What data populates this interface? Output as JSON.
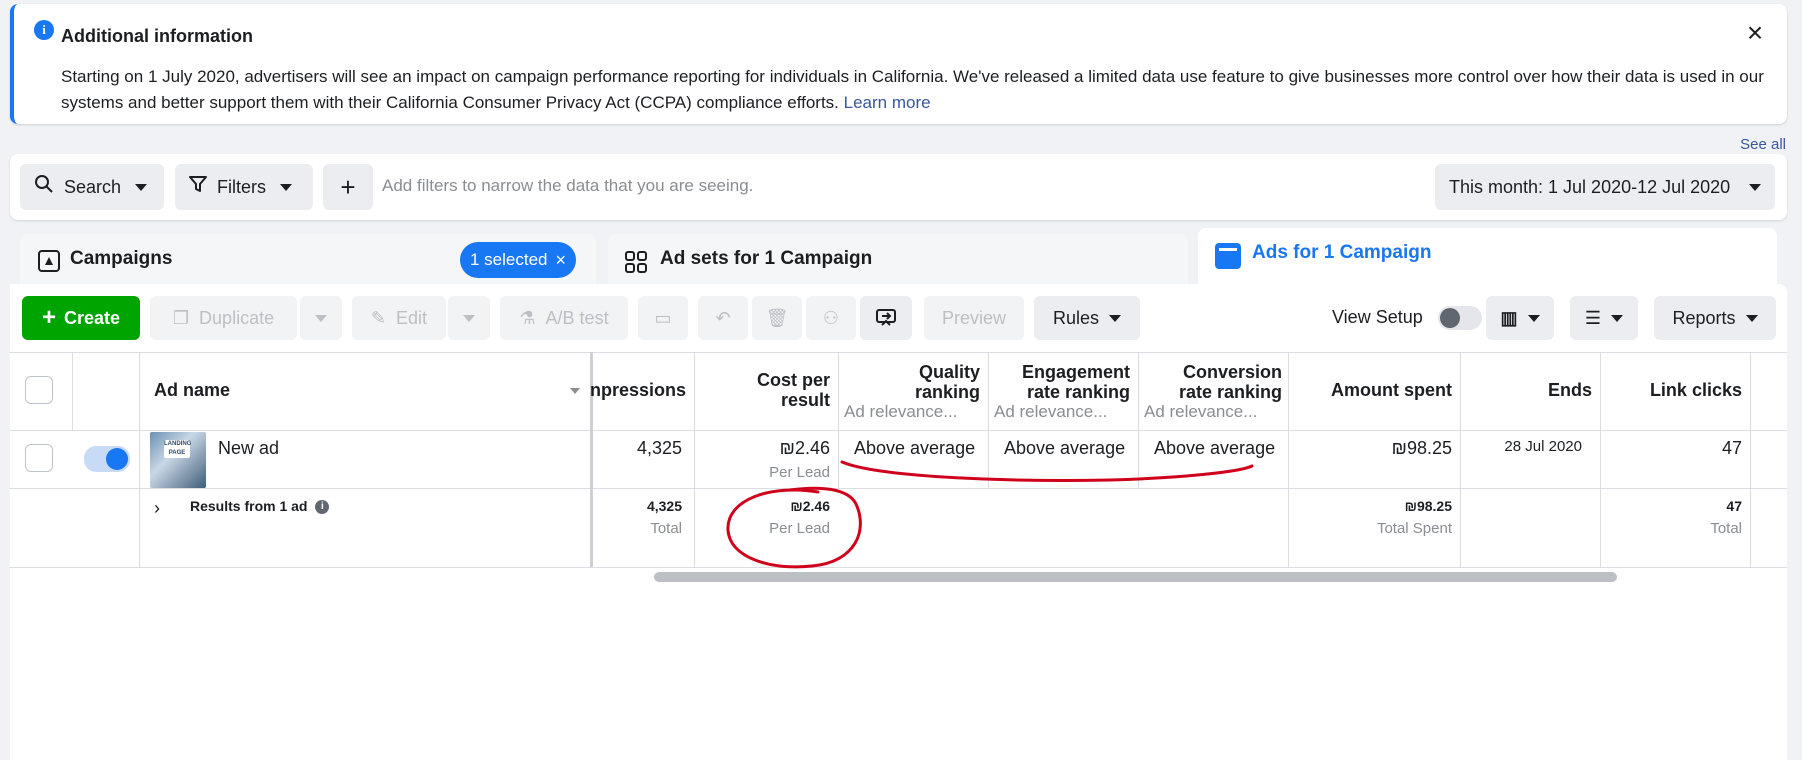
{
  "banner": {
    "title": "Additional information",
    "text": "Starting on 1 July 2020, advertisers will see an impact on campaign performance reporting for individuals in California. We've released a limited data use feature to give businesses more control over how their data is used in our systems and better support them with their California Consumer Privacy Act (CCPA) compliance efforts.",
    "link": "Learn more"
  },
  "see_all": "See all",
  "filters": {
    "search": "Search",
    "filters": "Filters",
    "add": "+",
    "placeholder": "Add filters to narrow the data that you are seeing.",
    "date_range": "This month: 1 Jul 2020-12 Jul 2020"
  },
  "tabs": {
    "campaigns": "Campaigns",
    "selected": "1 selected",
    "adsets": "Ad sets for 1 Campaign",
    "ads": "Ads for 1 Campaign"
  },
  "toolbar": {
    "create": "Create",
    "duplicate": "Duplicate",
    "edit": "Edit",
    "ab_test": "A/B test",
    "preview": "Preview",
    "rules": "Rules",
    "view_setup": "View Setup",
    "reports": "Reports"
  },
  "table": {
    "headers": {
      "ad_name": "Ad name",
      "impressions": "npressions",
      "cost_per_result_1": "Cost per",
      "cost_per_result_2": "result",
      "quality_1": "Quality",
      "quality_2": "ranking",
      "quality_sub": "Ad relevance...",
      "engagement_1": "Engagement",
      "engagement_2": "rate ranking",
      "engagement_sub": "Ad relevance...",
      "conversion_1": "Conversion",
      "conversion_2": "rate ranking",
      "conversion_sub": "Ad relevance...",
      "amount_spent": "Amount spent",
      "ends": "Ends",
      "link_clicks": "Link clicks"
    },
    "row": {
      "ad_name": "New ad",
      "thumb_text": "LANDING PAGE",
      "impressions": "4,325",
      "cost": "₪2.46",
      "cost_sub": "Per Lead",
      "quality": "Above average",
      "engagement": "Above average",
      "conversion": "Above average",
      "amount_spent": "₪98.25",
      "ends": "28 Jul 2020",
      "link_clicks": "47"
    },
    "summary": {
      "label": "Results from 1 ad",
      "impressions": "4,325",
      "impressions_sub": "Total",
      "cost": "₪2.46",
      "cost_sub": "Per Lead",
      "amount_spent": "₪98.25",
      "amount_sub": "Total Spent",
      "link_clicks": "47",
      "link_sub": "Total"
    }
  },
  "colors": {
    "accent": "#1877f2",
    "create_green": "#00a400",
    "annotation_red": "#d0021b"
  }
}
